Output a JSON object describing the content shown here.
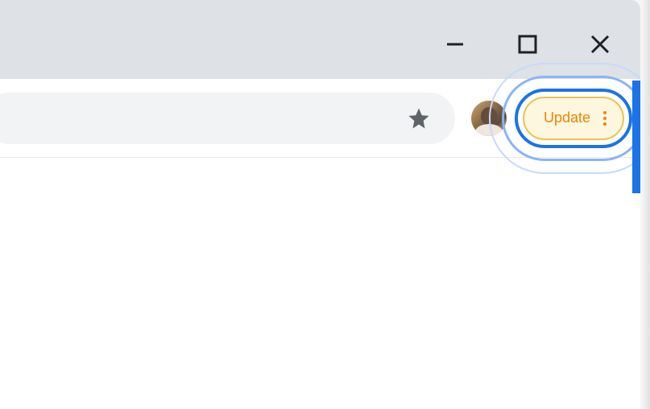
{
  "window": {
    "controls": {
      "minimize": "minimize",
      "maximize": "maximize",
      "close": "close"
    }
  },
  "toolbar": {
    "bookmark_icon": "star",
    "update_label": "Update",
    "more_icon": "more-vertical"
  },
  "colors": {
    "titlebar": "#dee1e6",
    "omnibox": "#f1f3f4",
    "update_border": "#f0c14b",
    "update_bg": "#fef7e0",
    "update_text": "#ea8600",
    "highlight_primary": "#1a73e8",
    "highlight_secondary": "#8ab4f8",
    "highlight_tertiary": "#c6dafc"
  }
}
